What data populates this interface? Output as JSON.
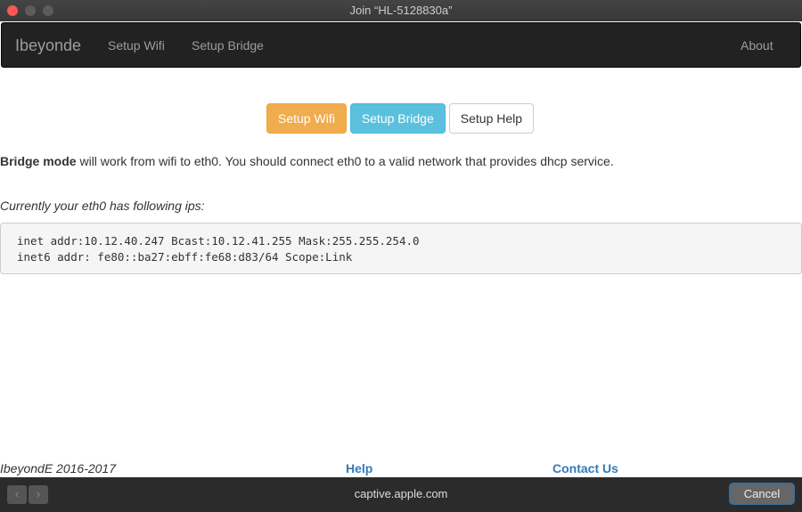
{
  "window": {
    "title": "Join “HL-5128830a”"
  },
  "nav": {
    "brand": "Ibeyonde",
    "items": [
      "Setup Wifi",
      "Setup Bridge"
    ],
    "about": "About"
  },
  "buttons": {
    "wifi": "Setup Wifi",
    "bridge": "Setup Bridge",
    "help": "Setup Help"
  },
  "content": {
    "bold": "Bridge mode",
    "text": " will work from wifi to eth0. You should connect eth0 to a valid network that provides dhcp service.",
    "ips_label": "Currently your eth0 has following ips:",
    "ips": [
      "inet addr:10.12.40.247 Bcast:10.12.41.255 Mask:255.255.254.0",
      "inet6 addr: fe80::ba27:ebff:fe68:d83/64 Scope:Link"
    ]
  },
  "footer": {
    "copyright": "IbeyondE 2016-2017",
    "help": "Help",
    "contact": "Contact Us"
  },
  "bottom": {
    "url": "captive.apple.com",
    "back": "‹",
    "forward": "›",
    "cancel": "Cancel"
  }
}
